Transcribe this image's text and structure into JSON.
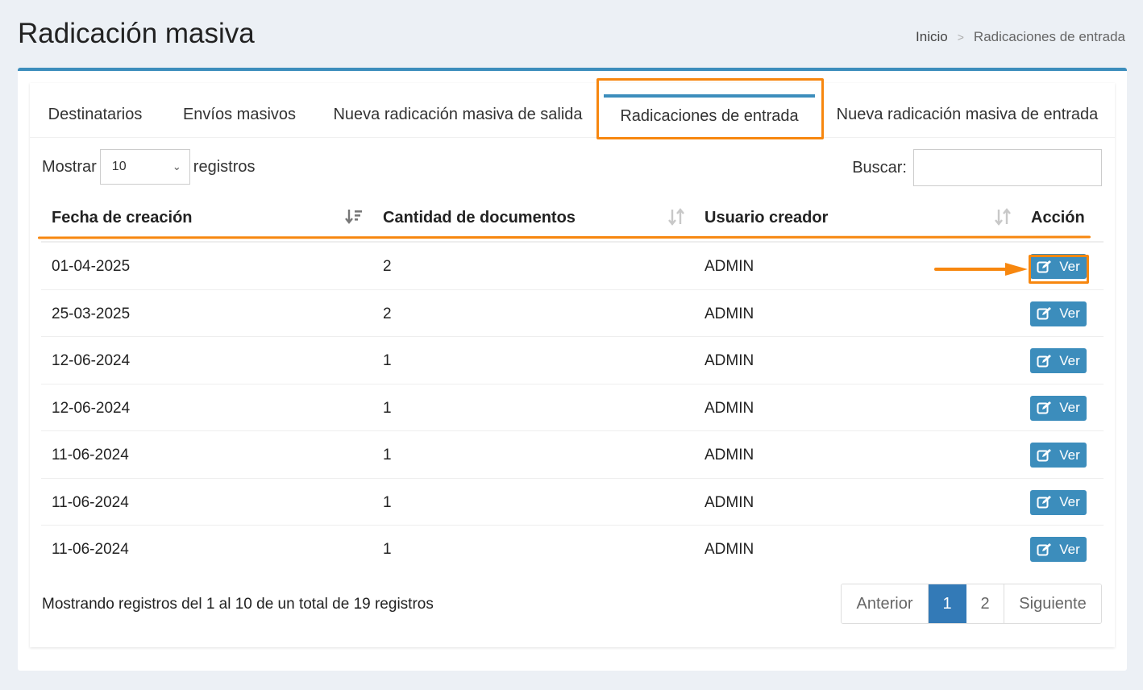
{
  "header": {
    "title": "Radicación masiva",
    "breadcrumb": {
      "home": "Inicio",
      "separator": ">",
      "current": "Radicaciones de entrada"
    }
  },
  "tabs": [
    {
      "label": "Destinatarios",
      "active": false
    },
    {
      "label": "Envíos masivos",
      "active": false
    },
    {
      "label": "Nueva radicación masiva de salida",
      "active": false
    },
    {
      "label": "Radicaciones de entrada",
      "active": true
    },
    {
      "label": "Nueva radicación masiva de entrada",
      "active": false
    }
  ],
  "controls": {
    "show_label": "Mostrar",
    "page_length": "10",
    "records_label": "registros",
    "search_label": "Buscar:",
    "search_value": ""
  },
  "table": {
    "columns": [
      "Fecha de creación",
      "Cantidad de documentos",
      "Usuario creador",
      "Acción"
    ],
    "rows": [
      {
        "fecha": "01-04-2025",
        "cantidad": "2",
        "usuario": "ADMIN",
        "accion": "Ver"
      },
      {
        "fecha": "25-03-2025",
        "cantidad": "2",
        "usuario": "ADMIN",
        "accion": "Ver"
      },
      {
        "fecha": "12-06-2024",
        "cantidad": "1",
        "usuario": "ADMIN",
        "accion": "Ver"
      },
      {
        "fecha": "12-06-2024",
        "cantidad": "1",
        "usuario": "ADMIN",
        "accion": "Ver"
      },
      {
        "fecha": "11-06-2024",
        "cantidad": "1",
        "usuario": "ADMIN",
        "accion": "Ver"
      },
      {
        "fecha": "11-06-2024",
        "cantidad": "1",
        "usuario": "ADMIN",
        "accion": "Ver"
      },
      {
        "fecha": "11-06-2024",
        "cantidad": "1",
        "usuario": "ADMIN",
        "accion": "Ver"
      }
    ]
  },
  "footer": {
    "info": "Mostrando registros del 1 al 10 de un total de 19 registros",
    "pagination": {
      "prev": "Anterior",
      "pages": [
        "1",
        "2"
      ],
      "current": "1",
      "next": "Siguiente"
    }
  },
  "icons": {
    "edit": "edit-icon",
    "sort_desc": "sort-desc-icon",
    "sort": "sort-icon",
    "dropdown": "chevron-down-icon"
  },
  "colors": {
    "primary": "#3c8dbc",
    "highlight": "#f7870f",
    "pager_active": "#337ab7"
  }
}
